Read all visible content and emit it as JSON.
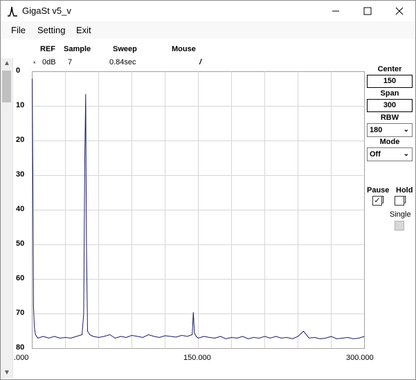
{
  "window": {
    "title": "GigaSt v5_v"
  },
  "menu": {
    "file": "File",
    "setting": "Setting",
    "exit": "Exit"
  },
  "header": {
    "ref_label": "REF",
    "ref_value": "0dB",
    "ref_marker": "*",
    "sample_label": "Sample",
    "sample_value": "7",
    "sweep_label": "Sweep",
    "sweep_value": "0.84sec",
    "mouse_label": "Mouse",
    "mouse_value": "/"
  },
  "controls": {
    "center_label": "Center",
    "center_value": "150",
    "span_label": "Span",
    "span_value": "300",
    "rbw_label": "RBW",
    "rbw_value": "180",
    "mode_label": "Mode",
    "mode_value": "Off",
    "pause_label": "Pause",
    "pause_checked": true,
    "hold_label": "Hold",
    "hold_checked": false,
    "single_label": "Single"
  },
  "chart_data": {
    "type": "line",
    "ylim": [
      0,
      80
    ],
    "y_inverted": true,
    "y_ticks": [
      "0",
      "10",
      "20",
      "30",
      "40",
      "50",
      "60",
      "70",
      "80"
    ],
    "xlim": [
      0,
      300
    ],
    "x_tick_labels": [
      ".000",
      "150.000",
      "300.000"
    ],
    "grid": true,
    "line_color": "#1a1a6e",
    "series": [
      {
        "x": [
          0,
          0.6,
          1.2,
          2,
          3,
          5,
          10,
          15,
          20,
          25,
          30,
          35,
          40,
          45,
          46.5,
          47.5,
          48.3,
          49,
          50,
          52,
          55,
          60,
          65,
          70,
          75,
          80,
          85,
          90,
          95,
          100,
          105,
          110,
          115,
          120,
          125,
          130,
          135,
          140,
          144.5,
          145.5,
          146.5,
          148,
          150,
          155,
          160,
          165,
          170,
          175,
          180,
          185,
          190,
          195,
          200,
          205,
          210,
          215,
          220,
          225,
          230,
          235,
          240,
          245,
          250,
          255,
          260,
          265,
          270,
          275,
          280,
          285,
          290,
          295,
          300
        ],
        "y": [
          2,
          30,
          68,
          74,
          76,
          77,
          76.5,
          77,
          76.5,
          77,
          76.8,
          77,
          76.5,
          76,
          70,
          25,
          6.5,
          50,
          75,
          76,
          76.5,
          76.8,
          76.5,
          76,
          77,
          76.5,
          76.8,
          76.2,
          76.5,
          76.8,
          76,
          76.5,
          76.8,
          76.3,
          76.5,
          76.7,
          76.2,
          76.5,
          76,
          69.5,
          75.5,
          76.5,
          77,
          76.5,
          76.8,
          77,
          76.5,
          77.2,
          76.8,
          77,
          76.5,
          77.2,
          76.8,
          77,
          76.5,
          77,
          76.5,
          77,
          76.8,
          77.2,
          76.5,
          75,
          77,
          76.8,
          77.2,
          77,
          76.5,
          77.2,
          77,
          76.8,
          77.2,
          77,
          76.5
        ]
      }
    ]
  }
}
